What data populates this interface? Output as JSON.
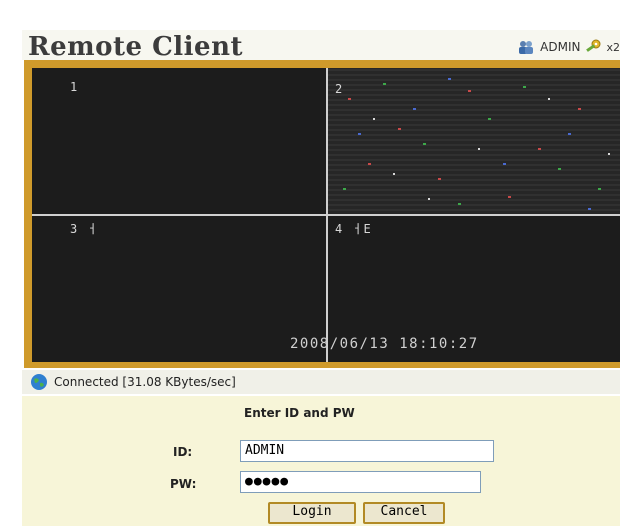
{
  "header": {
    "title": "Remote Client",
    "user": "ADMIN",
    "zoom": "x2"
  },
  "video": {
    "channels": [
      "1",
      "2",
      "3 ㅓ",
      "4 ㅓE"
    ],
    "timestamp": "2008/06/13  18:10:27"
  },
  "status": {
    "text": "Connected [31.08 KBytes/sec]"
  },
  "login": {
    "prompt": "Enter ID and PW",
    "id_label": "ID:",
    "id_value": "ADMIN",
    "pw_label": "PW:",
    "pw_value": "●●●●●",
    "login_button": "Login",
    "cancel_button": "Cancel"
  }
}
